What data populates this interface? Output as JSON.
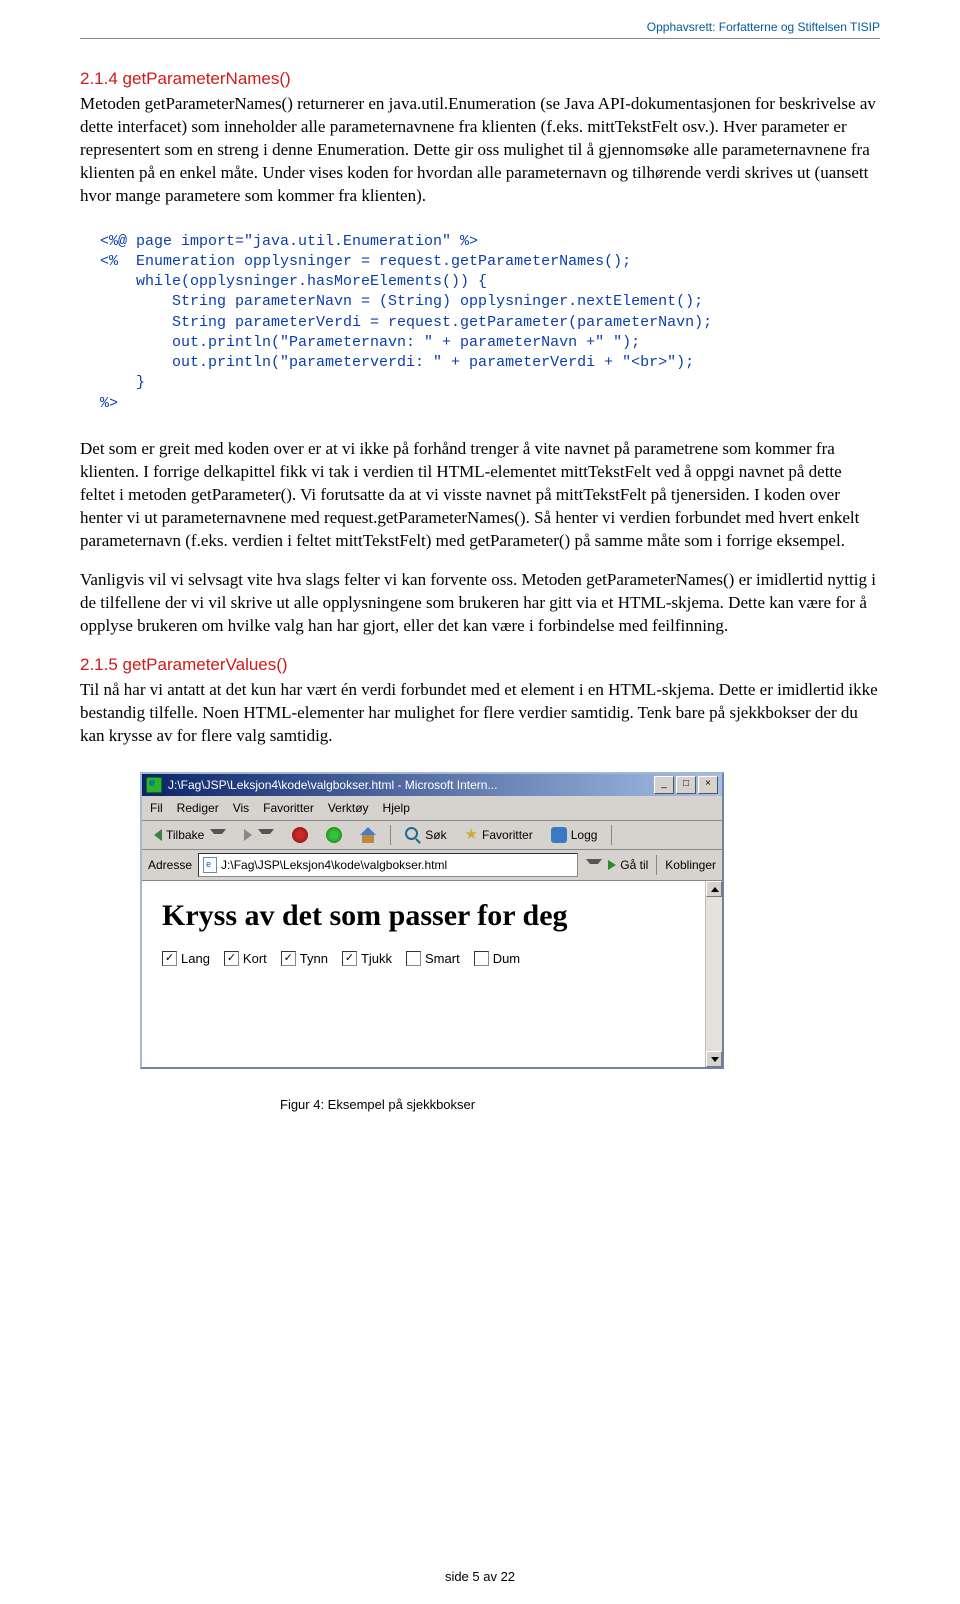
{
  "header": {
    "copyright": "Opphavsrett: Forfatterne og Stiftelsen TISIP"
  },
  "section1": {
    "number": "2.1.4",
    "title": "getParameterNames()",
    "para1": "Metoden getParameterNames() returnerer en java.util.Enumeration (se Java API-dokumentasjonen for beskrivelse av dette interfacet) som inneholder alle parameternavnene fra klienten (f.eks. mittTekstFelt osv.). Hver parameter er representert som en streng i denne Enumeration. Dette gir oss mulighet til å gjennomsøke alle parameternavnene fra klienten på en enkel måte. Under vises koden for hvordan alle parameternavn og tilhørende verdi skrives ut (uansett hvor mange parametere som kommer fra klienten)."
  },
  "code1": "<%@ page import=\"java.util.Enumeration\" %>\n<%  Enumeration opplysninger = request.getParameterNames();\n    while(opplysninger.hasMoreElements()) {\n        String parameterNavn = (String) opplysninger.nextElement();\n        String parameterVerdi = request.getParameter(parameterNavn);\n        out.println(\"Parameternavn: \" + parameterNavn +\" \");\n        out.println(\"parameterverdi: \" + parameterVerdi + \"<br>\");\n    }\n%>",
  "para2": "Det som er greit med koden over er at vi ikke på forhånd trenger å vite navnet på parametrene som kommer fra klienten. I forrige delkapittel fikk vi tak i verdien til HTML-elementet mittTekstFelt ved å oppgi navnet på dette feltet i metoden getParameter(). Vi forutsatte da at vi visste navnet på mittTekstFelt på tjenersiden. I koden over henter vi ut parameternavnene med request.getParameterNames(). Så henter vi verdien forbundet med hvert enkelt parameternavn (f.eks. verdien i feltet mittTekstFelt) med getParameter() på samme måte som i forrige eksempel.",
  "para3": "Vanligvis vil vi selvsagt vite hva slags felter vi kan forvente oss. Metoden getParameterNames() er imidlertid nyttig i de tilfellene der vi vil skrive ut alle opplysningene som brukeren har gitt via et HTML-skjema. Dette kan være for å opplyse brukeren om hvilke valg han har gjort, eller det kan være i forbindelse med feilfinning.",
  "section2": {
    "number": "2.1.5",
    "title": "getParameterValues()",
    "para1": "Til nå har vi antatt at det kun har vært én verdi forbundet med et element i en HTML-skjema. Dette er imidlertid ikke bestandig tilfelle. Noen HTML-elementer har mulighet for flere verdier samtidig. Tenk bare på sjekkbokser der du kan krysse av for flere valg samtidig."
  },
  "browser": {
    "title": "J:\\Fag\\JSP\\Leksjon4\\kode\\valgbokser.html - Microsoft Intern...",
    "menu": [
      "Fil",
      "Rediger",
      "Vis",
      "Favoritter",
      "Verktøy",
      "Hjelp"
    ],
    "toolbar": {
      "back": "Tilbake",
      "search": "Søk",
      "favorites": "Favoritter",
      "log": "Logg"
    },
    "addr": {
      "label": "Adresse",
      "value": "J:\\Fag\\JSP\\Leksjon4\\kode\\valgbokser.html",
      "go": "Gå til",
      "links": "Koblinger"
    },
    "content": {
      "heading": "Kryss av det som passer for deg",
      "checks": [
        {
          "label": "Lang",
          "checked": true
        },
        {
          "label": "Kort",
          "checked": true
        },
        {
          "label": "Tynn",
          "checked": true
        },
        {
          "label": "Tjukk",
          "checked": true
        },
        {
          "label": "Smart",
          "checked": false
        },
        {
          "label": "Dum",
          "checked": false
        }
      ]
    }
  },
  "caption": "Figur 4: Eksempel på sjekkbokser",
  "footer": "side 5 av 22"
}
